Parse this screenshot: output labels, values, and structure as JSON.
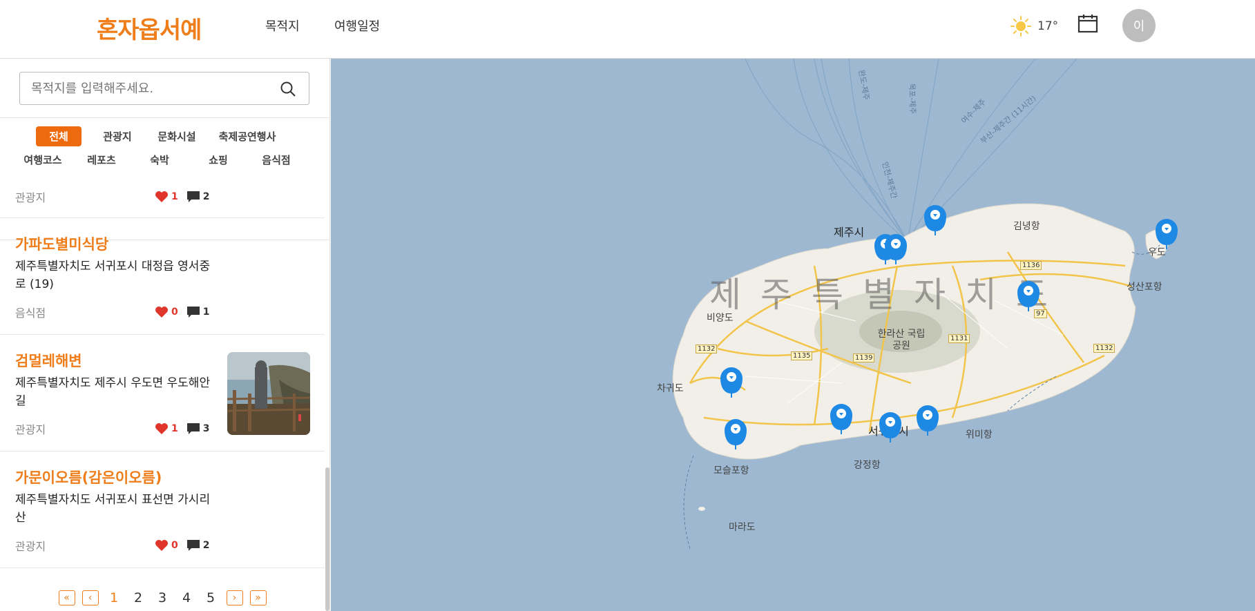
{
  "header": {
    "logo": "혼자옵서예",
    "nav": [
      "목적지",
      "여행일정"
    ],
    "temperature": "17°",
    "avatar_initial": "이"
  },
  "sidebar": {
    "search_placeholder": "목적지를 입력해주세요.",
    "categories_row1": [
      "전체",
      "관광지",
      "문화시설",
      "축제공연행사"
    ],
    "categories_row2": [
      "여행코스",
      "레포츠",
      "숙박",
      "쇼핑",
      "음식점"
    ],
    "active_category": "전체",
    "items": [
      {
        "title": "",
        "address": "",
        "category": "관광지",
        "likes": "1",
        "comments": "2"
      },
      {
        "title": "가파도별미식당",
        "address": "제주특별자치도 서귀포시 대정읍 영서중로 (19)",
        "category": "음식점",
        "likes": "0",
        "comments": "1"
      },
      {
        "title": "검멀레해변",
        "address": "제주특별자치도 제주시 우도면 우도해안길",
        "category": "관광지",
        "likes": "1",
        "comments": "3"
      },
      {
        "title": "가문이오름(감은이오름)",
        "address": "제주특별자치도 서귀포시 표선면 가시리 산",
        "category": "관광지",
        "likes": "0",
        "comments": "2"
      }
    ],
    "pagination": {
      "first": "«",
      "prev": "‹",
      "pages": [
        "1",
        "2",
        "3",
        "4",
        "5"
      ],
      "current": "1",
      "next": "›",
      "last": "»"
    }
  },
  "map": {
    "region_label": "제주특별자치도",
    "places": [
      "제주시",
      "서귀포시",
      "김녕항",
      "성산포항",
      "비양도",
      "차귀도",
      "모슬포항",
      "강정항",
      "위미항",
      "마라도",
      "한라산 국립공원",
      "우도"
    ],
    "road_numbers": [
      "1136",
      "97",
      "1132",
      "1135",
      "1139",
      "1131",
      "1132"
    ],
    "ferry_routes": [
      "완도-제주",
      "목포-제주",
      "여수-제주",
      "부산-제주간 (11시간)",
      "인천-제주간"
    ]
  },
  "colors": {
    "accent": "#ee7d1a",
    "map_sea": "#9db8d0",
    "marker": "#1e88e5",
    "heart": "#e0352b"
  }
}
